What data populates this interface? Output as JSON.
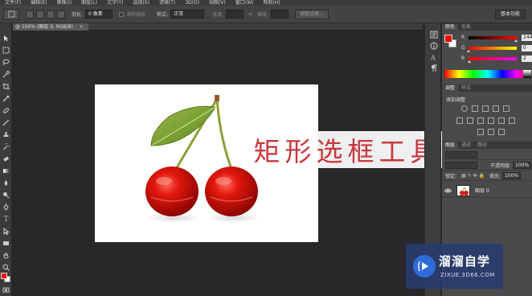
{
  "menu": [
    "文件(F)",
    "编辑(E)",
    "图像(I)",
    "图层(L)",
    "文字(Y)",
    "选择(S)",
    "滤镜(T)",
    "3D(D)",
    "视图(V)",
    "窗口(W)",
    "帮助(H)"
  ],
  "options_bar": {
    "feather_label": "羽化:",
    "feather_value": "0 像素",
    "antialias_label": "消除锯齿",
    "style_label": "样式:",
    "style_value": "正常",
    "width_label": "宽度:",
    "height_label": "高度:",
    "refine_edge": "调整边缘...",
    "workspace": "基本功能"
  },
  "document": {
    "tab_title": "@ 100% (图层 0, RGB/8)",
    "close": "×"
  },
  "caption": "矩形选框工具",
  "color_panel": {
    "tabs": [
      "颜色",
      "色板"
    ],
    "fg_color": "#f40202",
    "bg_color": "#ffffff",
    "channels": [
      {
        "name": "R",
        "value": "244"
      },
      {
        "name": "G",
        "value": "0"
      },
      {
        "name": "B",
        "value": "2"
      }
    ]
  },
  "adjustments_panel": {
    "tabs": [
      "调整",
      "样式"
    ],
    "title": "添加调整"
  },
  "layers_panel": {
    "tabs": [
      "图层",
      "通道",
      "路径"
    ],
    "opacity_label": "不透明度:",
    "opacity_value": "100%",
    "lock_label": "锁定:",
    "fill_label": "填充:",
    "fill_value": "100%",
    "layer_name": "图层 0"
  },
  "watermark": {
    "name": "溜溜自学",
    "url": "ZIXUE.3D66.COM"
  }
}
